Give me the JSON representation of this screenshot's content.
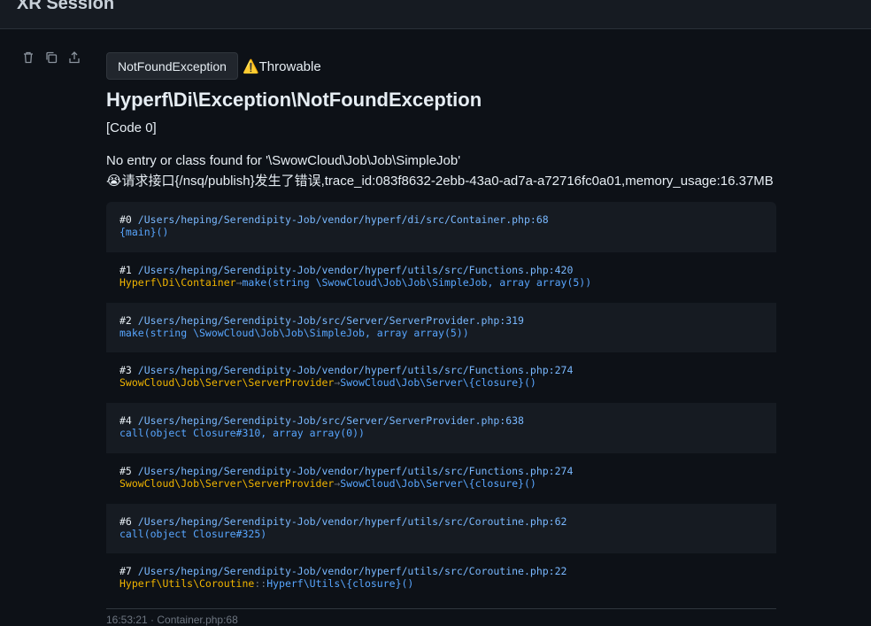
{
  "header": {
    "title": "XR Session"
  },
  "exception": {
    "badge": "NotFoundException",
    "type_label": "⚠️Throwable",
    "title": "Hyperf\\Di\\Exception\\NotFoundException",
    "code": "[Code 0]",
    "message_line1": "No entry or class found for '\\SwowCloud\\Job\\Job\\SimpleJob'",
    "message_line2": "😭请求接口{/nsq/publish}发生了错误,trace_id:083f8632-2ebb-43a0-ad7a-a72716fc0a01,memory_usage:16.37MB"
  },
  "trace": [
    {
      "index": "#0",
      "path": "/Users/heping/Serendipity-Job/vendor/hyperf/di/src/Container.php:68",
      "class": "",
      "sep": "",
      "call": "{main}()"
    },
    {
      "index": "#1",
      "path": "/Users/heping/Serendipity-Job/vendor/hyperf/utils/src/Functions.php:420",
      "class": "Hyperf\\Di\\Container",
      "sep": "→",
      "call": "make(string \\SwowCloud\\Job\\Job\\SimpleJob, array array(5))"
    },
    {
      "index": "#2",
      "path": "/Users/heping/Serendipity-Job/src/Server/ServerProvider.php:319",
      "class": "",
      "sep": "",
      "call": "make(string \\SwowCloud\\Job\\Job\\SimpleJob, array array(5))"
    },
    {
      "index": "#3",
      "path": "/Users/heping/Serendipity-Job/vendor/hyperf/utils/src/Functions.php:274",
      "class": "SwowCloud\\Job\\Server\\ServerProvider",
      "sep": "→",
      "call": "SwowCloud\\Job\\Server\\{closure}()"
    },
    {
      "index": "#4",
      "path": "/Users/heping/Serendipity-Job/src/Server/ServerProvider.php:638",
      "class": "",
      "sep": "",
      "call": "call(object Closure#310, array array(0))"
    },
    {
      "index": "#5",
      "path": "/Users/heping/Serendipity-Job/vendor/hyperf/utils/src/Functions.php:274",
      "class": "SwowCloud\\Job\\Server\\ServerProvider",
      "sep": "→",
      "call": "SwowCloud\\Job\\Server\\{closure}()"
    },
    {
      "index": "#6",
      "path": "/Users/heping/Serendipity-Job/vendor/hyperf/utils/src/Coroutine.php:62",
      "class": "",
      "sep": "",
      "call": "call(object Closure#325)"
    },
    {
      "index": "#7",
      "path": "/Users/heping/Serendipity-Job/vendor/hyperf/utils/src/Coroutine.php:22",
      "class": "Hyperf\\Utils\\Coroutine",
      "sep": "::",
      "call": "Hyperf\\Utils\\{closure}()"
    }
  ],
  "footer": {
    "meta": "16:53:21 · Container.php:68"
  },
  "icons": {
    "delete": "trash-icon",
    "copy": "copy-icon",
    "share": "share-icon"
  },
  "colors": {
    "background": "#0d1117",
    "path": "#79b8ff",
    "class": "#f0b400",
    "call": "#58a6ff"
  }
}
